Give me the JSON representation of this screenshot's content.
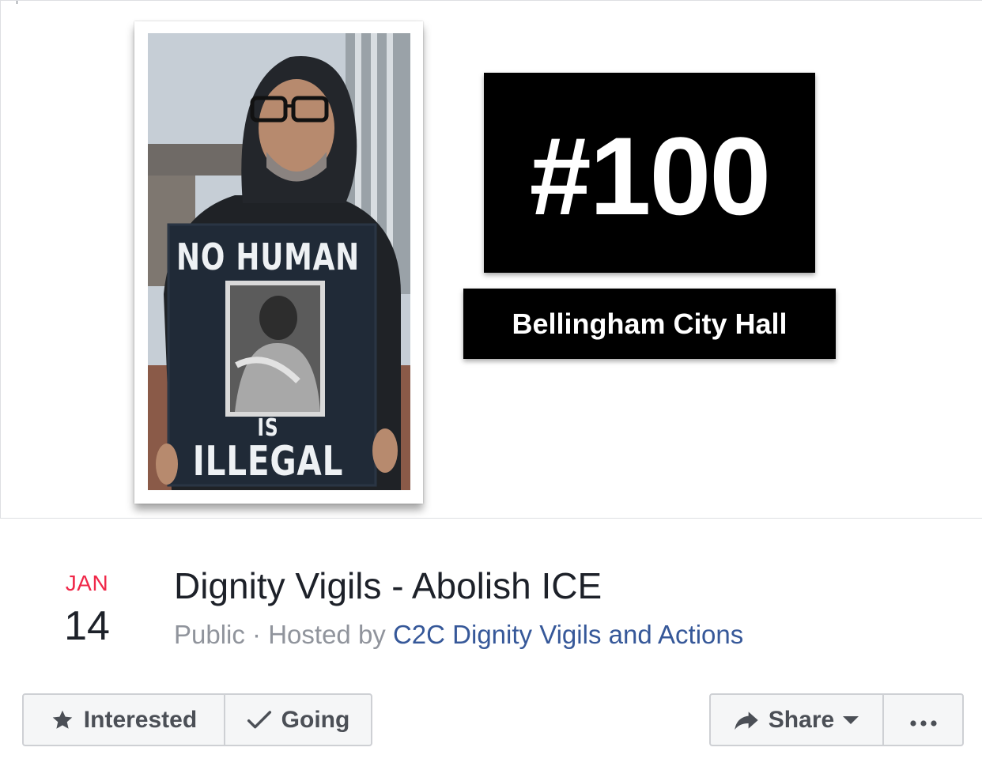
{
  "cover": {
    "sign_top": "NO HUMAN",
    "sign_middle": "IS",
    "sign_bottom": "ILLEGAL",
    "vigil_number": "#100",
    "location": "Bellingham City Hall"
  },
  "event": {
    "month": "JAN",
    "day": "14",
    "title": "Dignity Vigils - Abolish ICE",
    "privacy": "Public",
    "hosted_by_prefix": " · Hosted by ",
    "host": "C2C Dignity Vigils and Actions"
  },
  "actions": {
    "interested": {
      "label": "Interested",
      "icon": "star-icon"
    },
    "going": {
      "label": "Going",
      "icon": "checkmark-icon"
    },
    "share": {
      "label": "Share",
      "icon": "share-arrow-icon"
    },
    "more": {
      "icon": "more-dots-icon"
    }
  },
  "colors": {
    "month": "#f02849",
    "link": "#365899",
    "meta": "#90949c",
    "button_bg": "#f5f6f7",
    "button_border": "#ced0d4"
  }
}
